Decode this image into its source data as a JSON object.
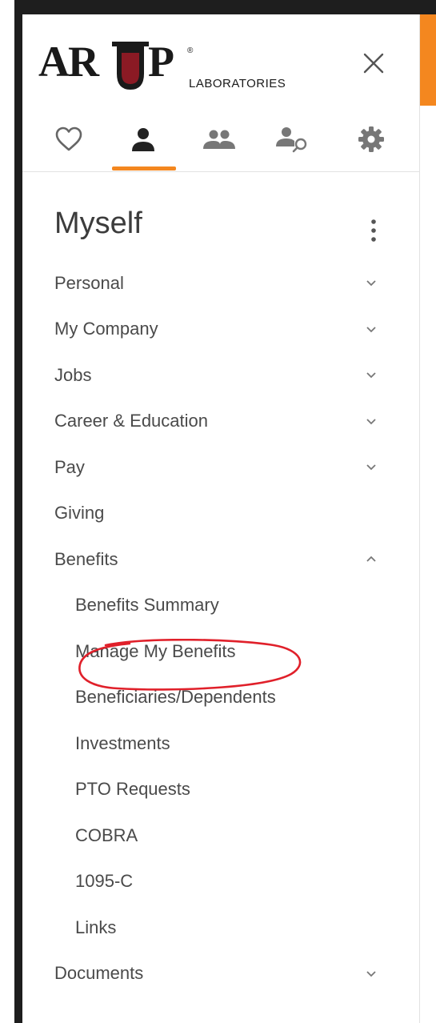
{
  "header": {
    "logo_main": "AR",
    "logo_after": "P",
    "logo_sub": "LABORATORIES",
    "logo_reg": "®"
  },
  "tabs": [
    {
      "name": "favorites",
      "icon": "heart-outline-icon"
    },
    {
      "name": "myself",
      "icon": "person-icon",
      "active": true
    },
    {
      "name": "team",
      "icon": "people-icon"
    },
    {
      "name": "people-search",
      "icon": "person-search-icon"
    },
    {
      "name": "settings",
      "icon": "gear-icon"
    }
  ],
  "section": {
    "title": "Myself"
  },
  "menu": {
    "personal": "Personal",
    "my_company": "My Company",
    "jobs": "Jobs",
    "career": "Career & Education",
    "pay": "Pay",
    "giving": "Giving",
    "benefits": "Benefits",
    "benefits_summary": "Benefits Summary",
    "manage_benefits": "Manage My Benefits",
    "beneficiaries": "Beneficiaries/Dependents",
    "investments": "Investments",
    "pto": "PTO Requests",
    "cobra": "COBRA",
    "form_1095": "1095-C",
    "links": "Links",
    "documents": "Documents"
  },
  "colors": {
    "accent": "#f4871f",
    "annotation": "#e0202a",
    "logo_red": "#8b1a24",
    "text": "#4a4a4a"
  }
}
